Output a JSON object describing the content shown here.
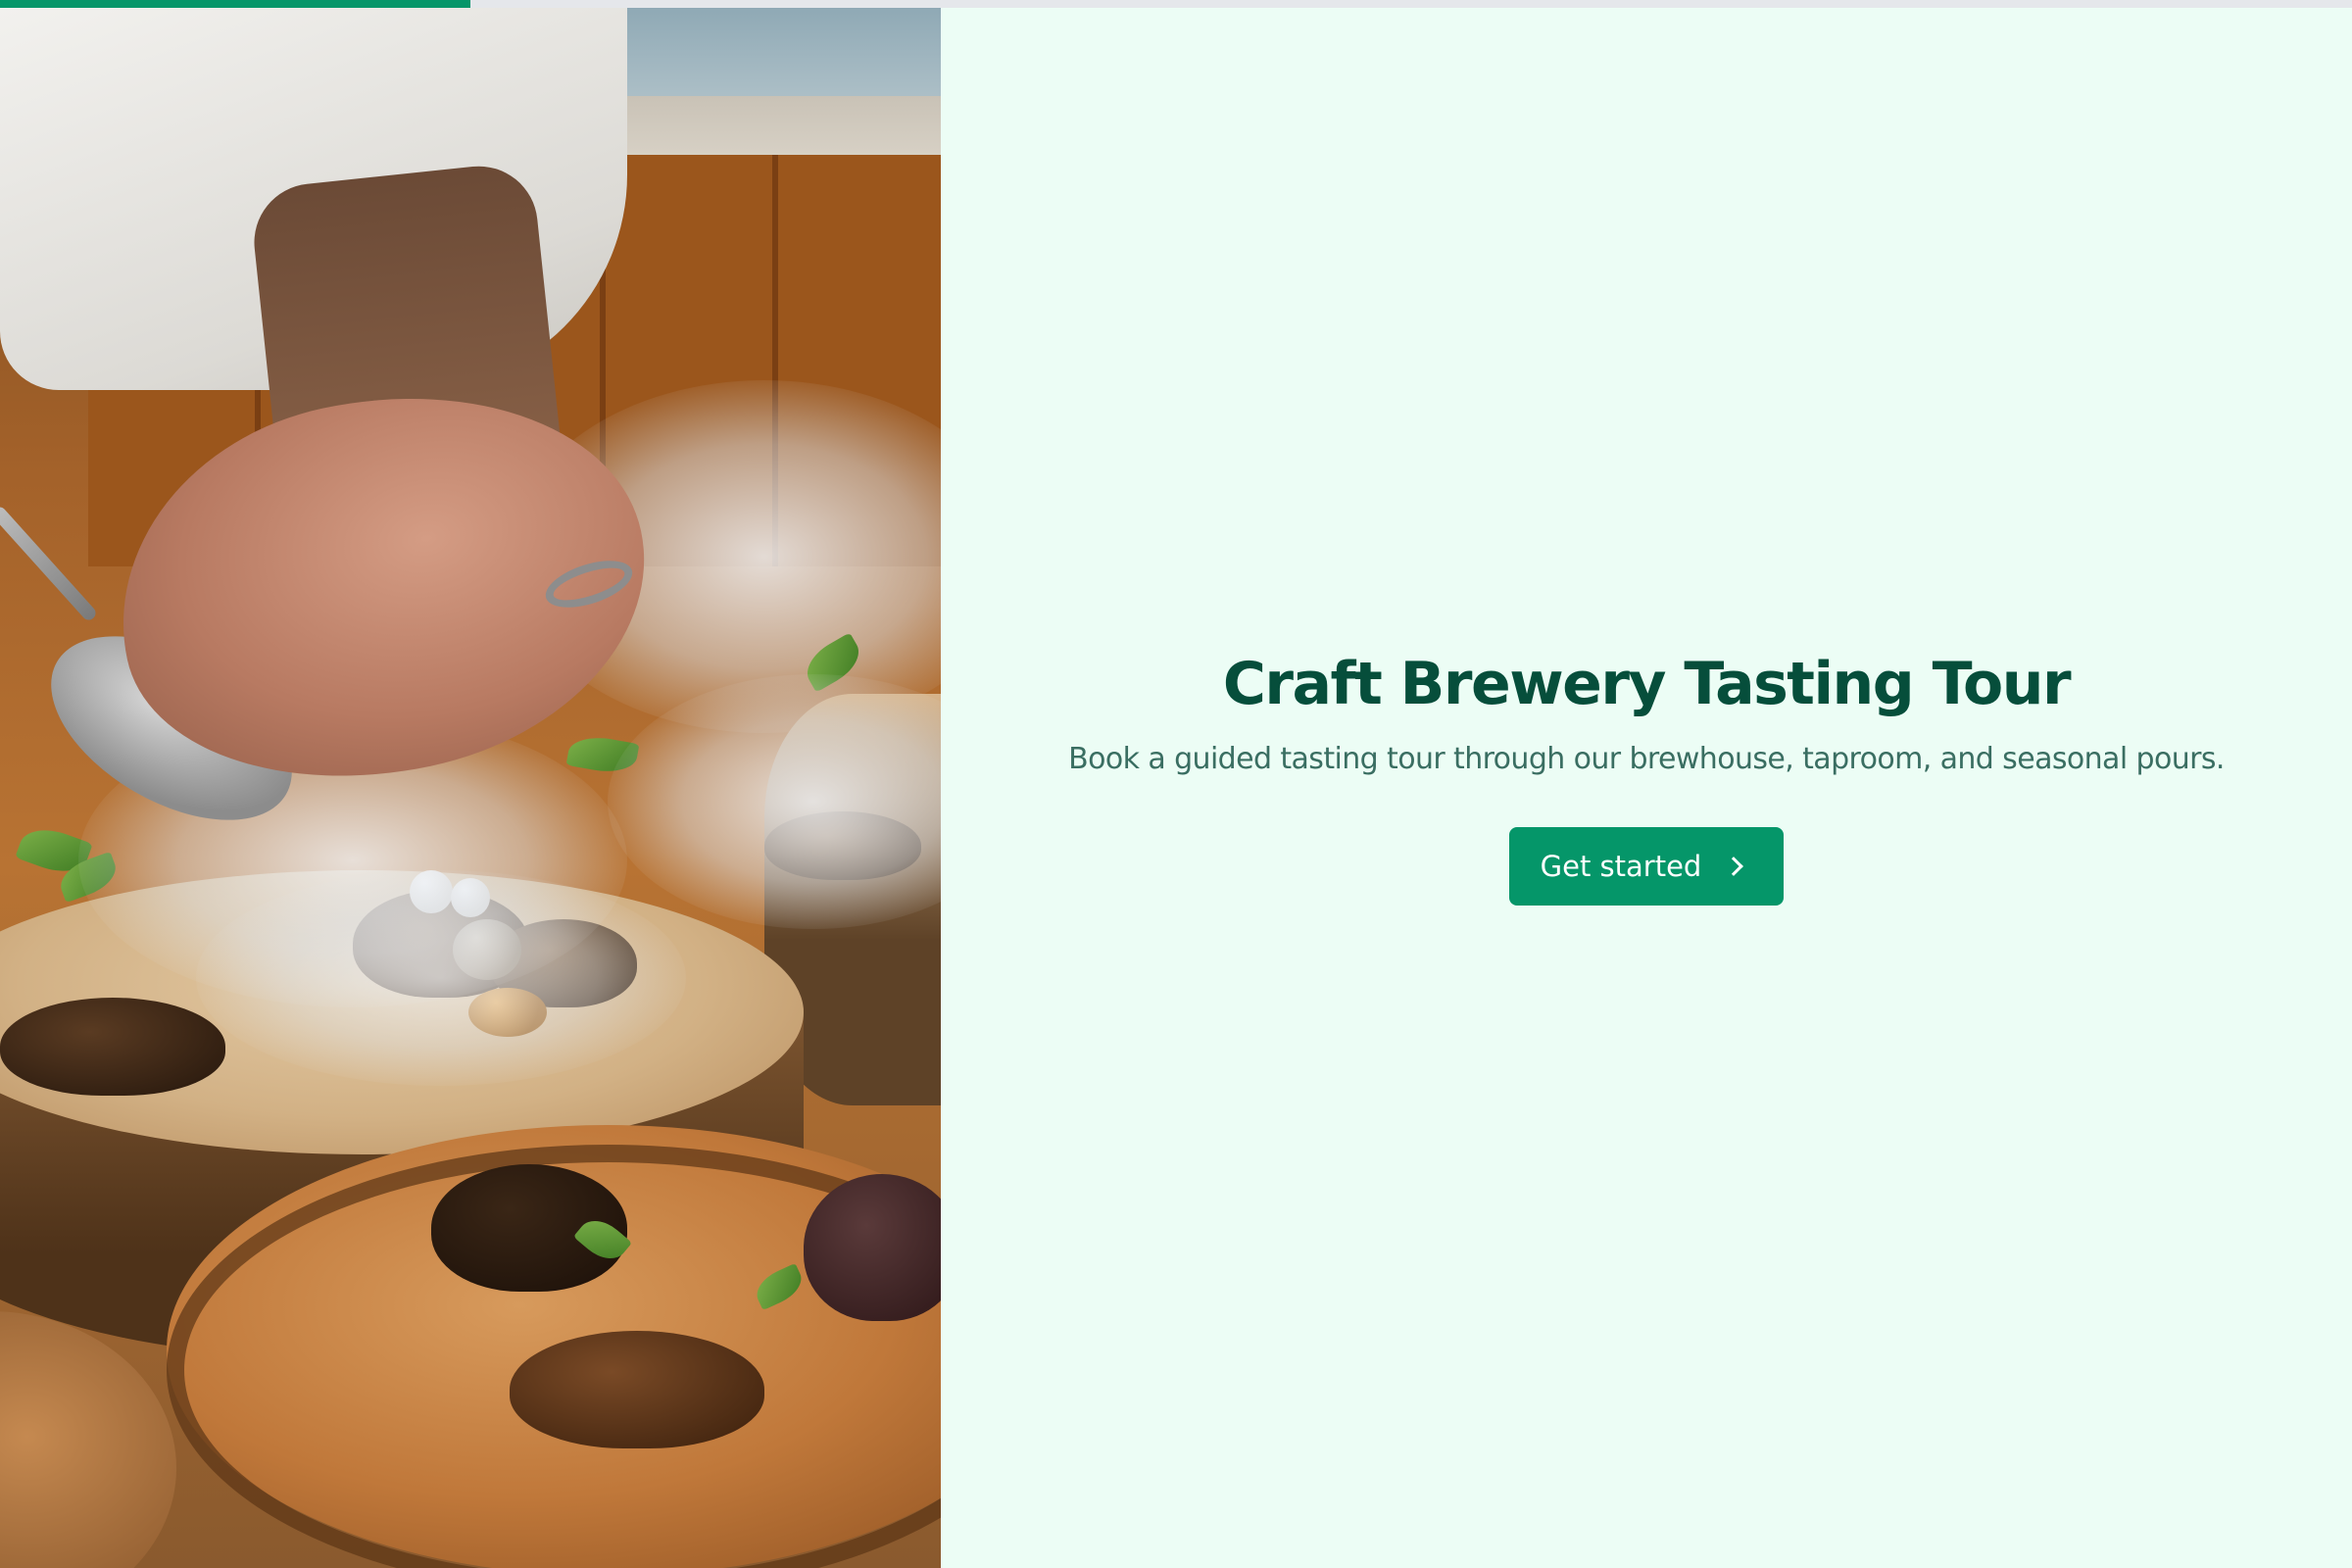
{
  "progress": {
    "value_percent": 20,
    "fill_color": "#059669",
    "track_color": "#e5e7eb"
  },
  "hero_image": {
    "icon": "photo-chef-plating-food"
  },
  "hero": {
    "title": "Craft Brewery Tasting Tour",
    "subtitle": "Book a guided tasting tour through our brewhouse, taproom, and seasonal pours.",
    "cta_label": "Get started",
    "cta_icon": "chevron-right-icon"
  },
  "colors": {
    "background": "#ecfdf5",
    "title": "#064e3b",
    "subtitle": "#3a6e62",
    "button": "#059669",
    "button_text": "#ffffff"
  }
}
